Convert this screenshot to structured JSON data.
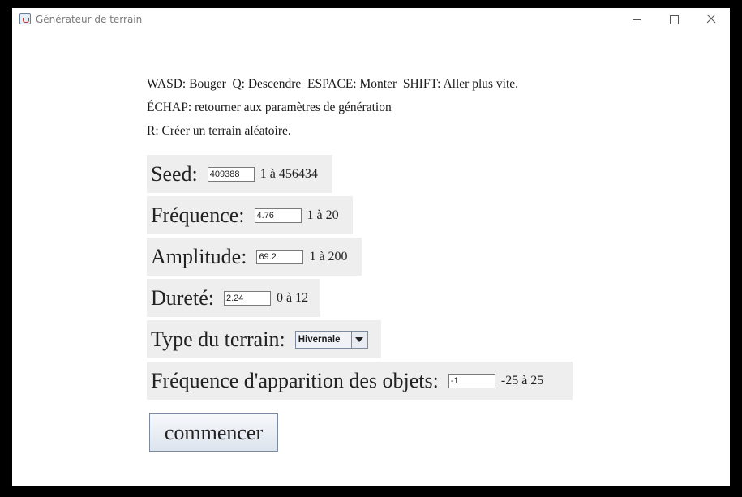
{
  "window": {
    "title": "Générateur de terrain"
  },
  "instructions": [
    "WASD: Bouger  Q: Descendre  ESPACE: Monter  SHIFT: Aller plus vite.",
    "ÉCHAP: retourner aux paramètres de génération",
    "R: Créer un terrain aléatoire."
  ],
  "fields": {
    "seed": {
      "label": "Seed:",
      "value": "409388",
      "range": "1 à 456434"
    },
    "frequence": {
      "label": "Fréquence:",
      "value": "4.76",
      "range": "1 à 20"
    },
    "amplitude": {
      "label": "Amplitude:",
      "value": "69.2",
      "range": "1 à 200"
    },
    "durete": {
      "label": "Dureté:",
      "value": "2.24",
      "range": "0 à 12"
    },
    "type": {
      "label": "Type du terrain:",
      "selected": "Hivernale"
    },
    "objets": {
      "label": "Fréquence d'apparition des objets:",
      "value": "-1",
      "range": "-25 à 25"
    }
  },
  "start_button": "commencer",
  "icons": {
    "app": "java-cup-icon",
    "minimize": "minimize-icon",
    "maximize": "maximize-icon",
    "close": "close-icon"
  }
}
